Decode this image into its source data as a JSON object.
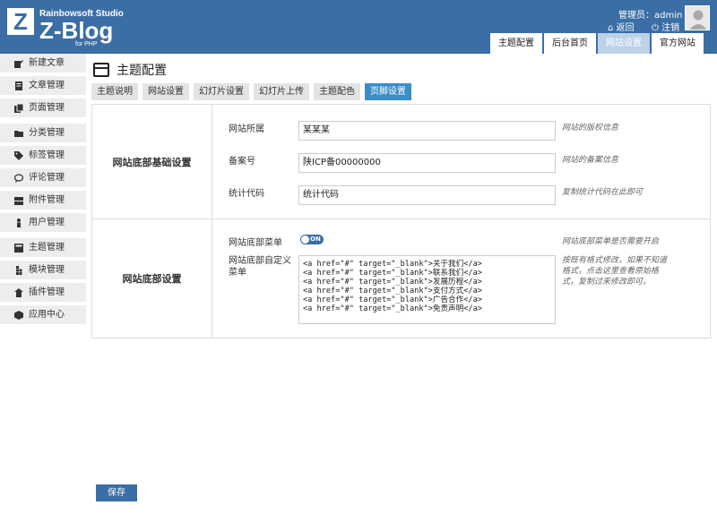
{
  "header": {
    "logo_letter": "Z",
    "studio": "Rainbowsoft Studio",
    "brand": "Z-Blog",
    "brand_sub": "for PHP",
    "admin_label": "管理员：admin",
    "back_label": "返回",
    "logout_label": "注销",
    "tabs": [
      {
        "label": "主题配置",
        "active": false
      },
      {
        "label": "后台首页",
        "active": false
      },
      {
        "label": "网站设置",
        "active": true
      },
      {
        "label": "官方网站",
        "active": false
      }
    ]
  },
  "sidebar": {
    "items": [
      {
        "label": "新建文章",
        "icon": "edit-icon"
      },
      {
        "label": "文章管理",
        "icon": "article-icon"
      },
      {
        "label": "页面管理",
        "icon": "page-icon"
      },
      {
        "label": "分类管理",
        "icon": "folder-icon"
      },
      {
        "label": "标签管理",
        "icon": "tag-icon"
      },
      {
        "label": "评论管理",
        "icon": "comment-icon"
      },
      {
        "label": "附件管理",
        "icon": "attachment-icon"
      },
      {
        "label": "用户管理",
        "icon": "user-icon"
      },
      {
        "label": "主题管理",
        "icon": "theme-icon"
      },
      {
        "label": "模块管理",
        "icon": "module-icon"
      },
      {
        "label": "插件管理",
        "icon": "plugin-icon"
      },
      {
        "label": "应用中心",
        "icon": "app-center-icon"
      }
    ]
  },
  "main": {
    "title": "主题配置",
    "sub_tabs": [
      {
        "label": "主题说明",
        "active": false
      },
      {
        "label": "网站设置",
        "active": false
      },
      {
        "label": "幻灯片设置",
        "active": false
      },
      {
        "label": "幻灯片上传",
        "active": false
      },
      {
        "label": "主题配色",
        "active": false
      },
      {
        "label": "页脚设置",
        "active": true
      }
    ],
    "section1": {
      "title": "网站底部基础设置",
      "fields": [
        {
          "label": "网站所属",
          "value": "某某某",
          "desc": "网站的版权信息"
        },
        {
          "label": "备案号",
          "value": "陕ICP备00000000",
          "desc": "网站的备案信息"
        },
        {
          "label": "统计代码",
          "value": "统计代码",
          "desc": "复制统计代码在此即可"
        }
      ]
    },
    "section2": {
      "title": "网站底部设置",
      "toggle_label": "网站底部菜单",
      "toggle_text": "ON",
      "toggle_on": true,
      "toggle_desc": "网站底部菜单是否需要开启",
      "menu_label": "网站底部自定义菜单",
      "menu_lines": [
        "<a href=\"#\" target=\"_blank\">关于我们</a>",
        "<a href=\"#\" target=\"_blank\">联系我们</a>",
        "<a href=\"#\" target=\"_blank\">发展历程</a>",
        "<a href=\"#\" target=\"_blank\">支付方式</a>",
        "<a href=\"#\" target=\"_blank\">广告合作</a>",
        "<a href=\"#\" target=\"_blank\">免责声明</a>"
      ],
      "menu_desc": "按既有格式修改，如果不知道格式，点击这里查看原始格式，复制过来修改即可。"
    },
    "save_label": "保存"
  }
}
